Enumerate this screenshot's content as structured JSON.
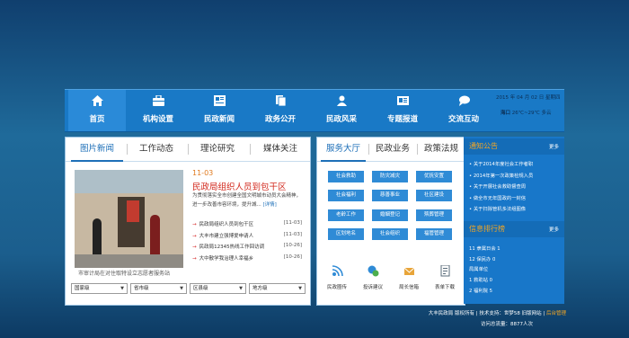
{
  "nav": {
    "items": [
      {
        "label": "首页",
        "icon": "home-icon"
      },
      {
        "label": "机构设置",
        "icon": "briefcase-icon"
      },
      {
        "label": "民政新闻",
        "icon": "news-icon"
      },
      {
        "label": "政务公开",
        "icon": "document-icon"
      },
      {
        "label": "民政风采",
        "icon": "person-icon"
      },
      {
        "label": "专题报道",
        "icon": "newspaper-icon"
      },
      {
        "label": "交流互动",
        "icon": "chat-icon"
      }
    ],
    "date": "2015 年 04 月 02 日 星期四",
    "weather_city": "海口",
    "weather_temp": "26℃~29℃ 多云"
  },
  "news_panel": {
    "tabs": [
      "图片新闻",
      "工作动态",
      "理论研究",
      "媒体关注"
    ],
    "slide_indicators": [
      "1",
      "2",
      "3",
      "4"
    ],
    "caption": "市审计局在对住取特设立志愿者服务站",
    "featured": {
      "date": "11-03",
      "title": "民政局组织人员到包干区",
      "desc": "为贯彻落实全市创建全国文明城市动员大会精神，进一步改善市容环境，提升城...",
      "more": "[详情]"
    },
    "list": [
      {
        "title": "民政局组织人员到包干区",
        "date": "[11-03]"
      },
      {
        "title": "大丰市建立强博爱申请人",
        "date": "[11-03]"
      },
      {
        "title": "民政局12345热线工作回访调",
        "date": "[10-26]"
      },
      {
        "title": "大中散学我治理人幸福乡",
        "date": "[10-26]"
      }
    ],
    "selects": [
      "国家级",
      "省市级",
      "区县级",
      "地方级"
    ]
  },
  "service_panel": {
    "tabs": [
      "服务大厅",
      "民政业务",
      "政策法规"
    ],
    "buttons": [
      "社会救助",
      "防灾减灾",
      "优抚安置",
      "社会福利",
      "慈善事业",
      "社区建设",
      "老龄工作",
      "婚姻登记",
      "殡葬管理",
      "区划地名",
      "社会组织",
      "福管管理"
    ],
    "tools": [
      {
        "label": "民政圈传",
        "icon": "rss-icon"
      },
      {
        "label": "投诉建议",
        "icon": "feedback-icon"
      },
      {
        "label": "局长信箱",
        "icon": "mailbox-icon"
      },
      {
        "label": "表单下载",
        "icon": "download-icon"
      }
    ]
  },
  "sidebar": {
    "notice_title": "通知公告",
    "notice_more": "更多",
    "notices": [
      "关于2014年度社会工作者职",
      "2014年第一次政策检规入员",
      "关于开展社会救助督查周",
      "做全市无年国政的一封信",
      "关于扫除管机多法组图像"
    ],
    "rank_title": "信息排行榜",
    "rank_more": "更多",
    "ranks": [
      "11 隶属日会 1",
      "12 保民办 0",
      "局属单位",
      "1  救助站 0",
      "2  福利院 5"
    ]
  },
  "footer": {
    "line1_prefix": "大丰民政局  版权所有 | 技术支持：",
    "line1_mid": "世梦58  旧版网站 |",
    "line1_link": "后台管理",
    "line2": "访问总流量：8877人次"
  }
}
